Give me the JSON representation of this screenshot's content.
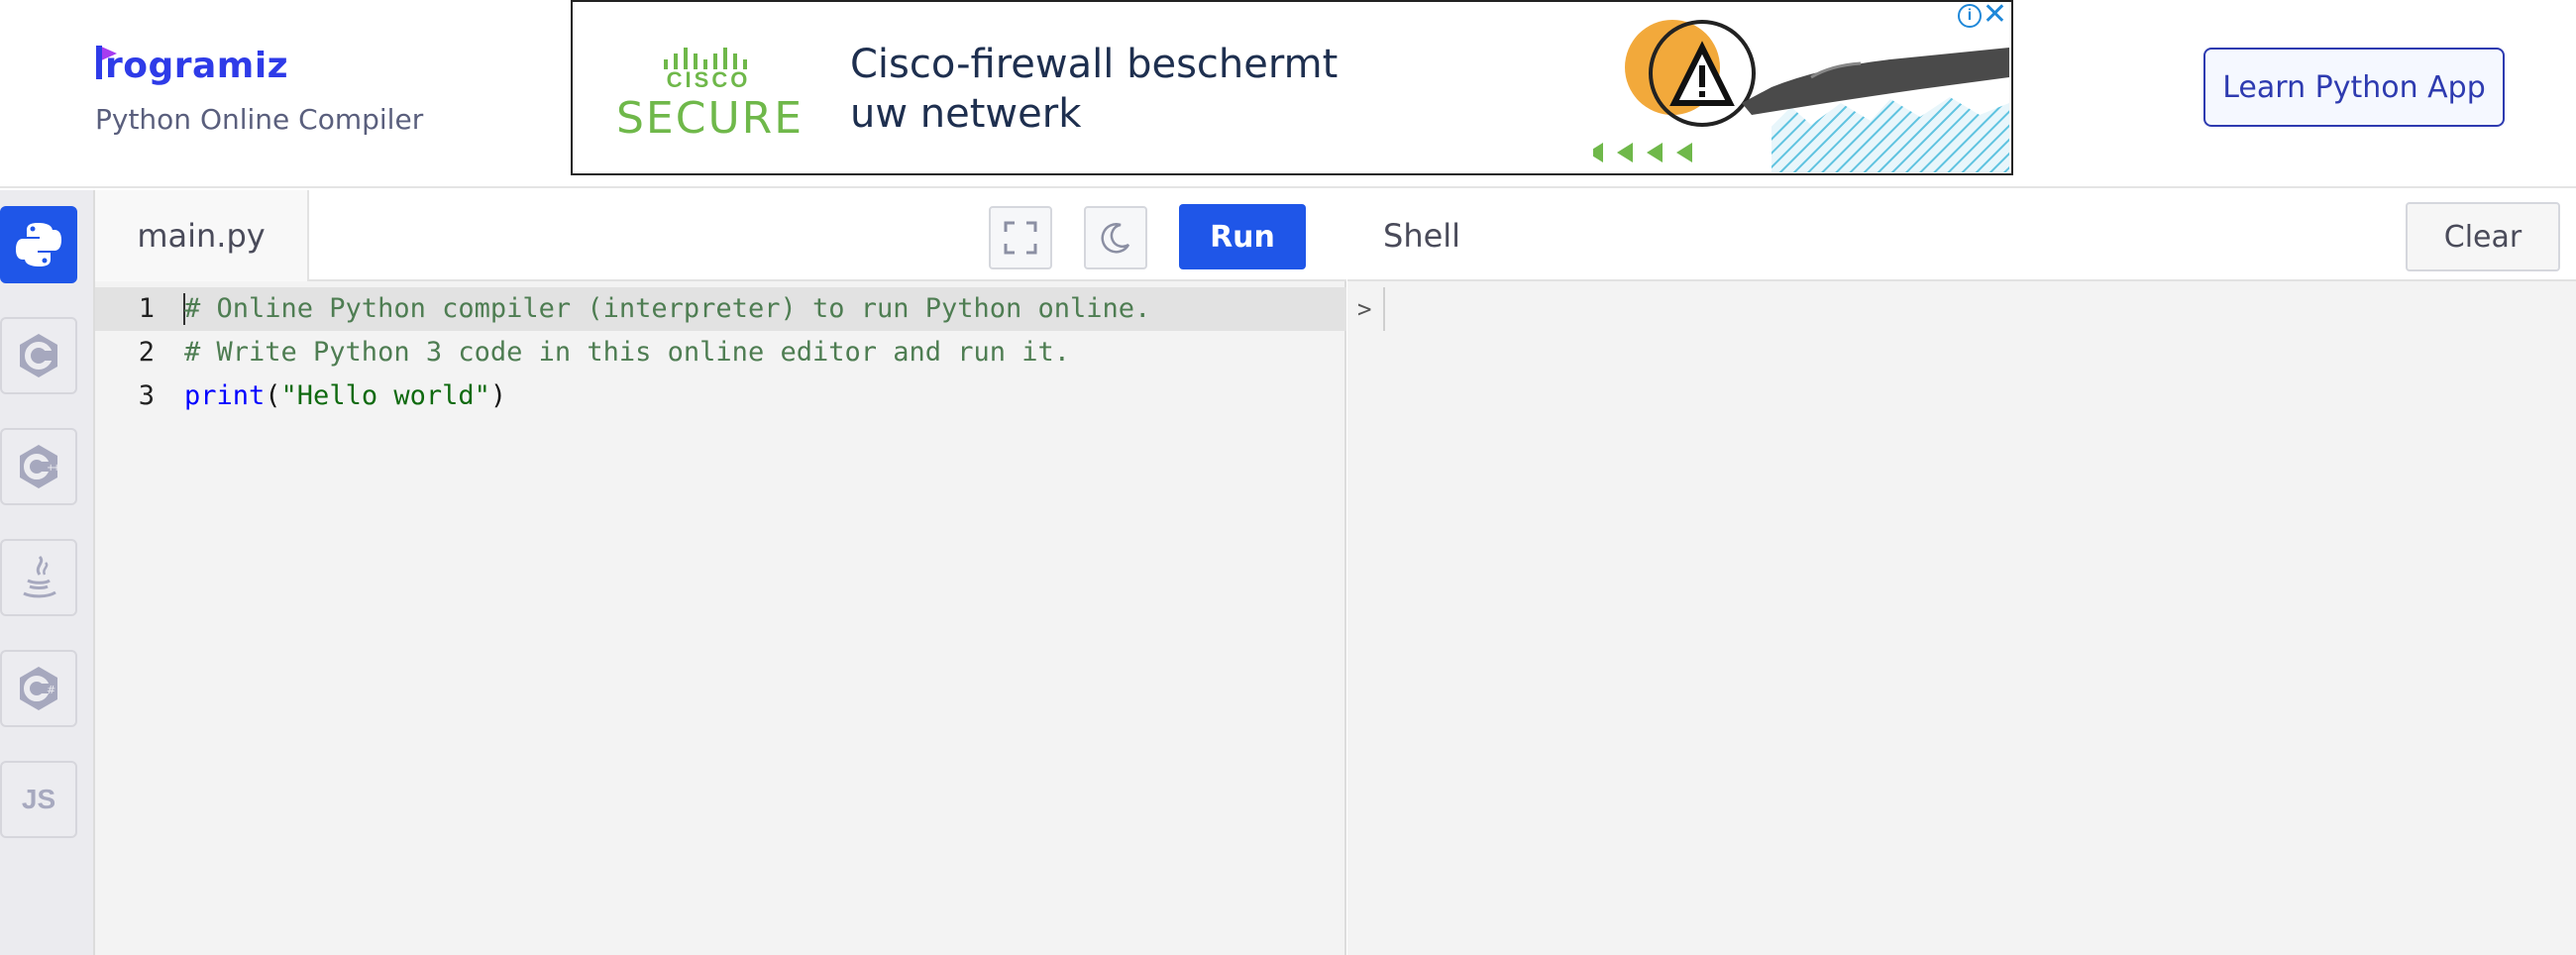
{
  "brand": {
    "name": "rogramiz",
    "logo_letter": "P",
    "subtitle": "Python Online Compiler"
  },
  "ad": {
    "sponsor_word": "CISCO",
    "sponsor_product": "SECURE",
    "headline_line1": "Cisco-firewall beschermt",
    "headline_line2": "uw netwerk",
    "info_glyph": "i",
    "close_glyph": "✕"
  },
  "header": {
    "cta_label": "Learn Python App"
  },
  "sidebar": {
    "items": [
      {
        "icon": "python-icon",
        "active": true
      },
      {
        "icon": "c-icon"
      },
      {
        "icon": "cpp-icon"
      },
      {
        "icon": "java-icon"
      },
      {
        "icon": "csharp-icon"
      },
      {
        "icon": "js-icon",
        "label": "JS"
      }
    ]
  },
  "editor": {
    "file_tab": "main.py",
    "run_label": "Run",
    "lines": [
      {
        "number": "1",
        "text": "# Online Python compiler (interpreter) to run Python online."
      },
      {
        "number": "2",
        "text": "# Write Python 3 code in this online editor and run it."
      },
      {
        "number": "3",
        "fn": "print",
        "open": "(",
        "arg": "\"Hello world\"",
        "close": ")"
      }
    ]
  },
  "shell": {
    "title": "Shell",
    "clear_label": "Clear",
    "prompt": ">"
  },
  "colors": {
    "accent": "#1f56e8",
    "brand": "#2e3be8",
    "comment": "#4e7d52",
    "keyword": "#0000ff",
    "string": "#0f6a0f"
  }
}
